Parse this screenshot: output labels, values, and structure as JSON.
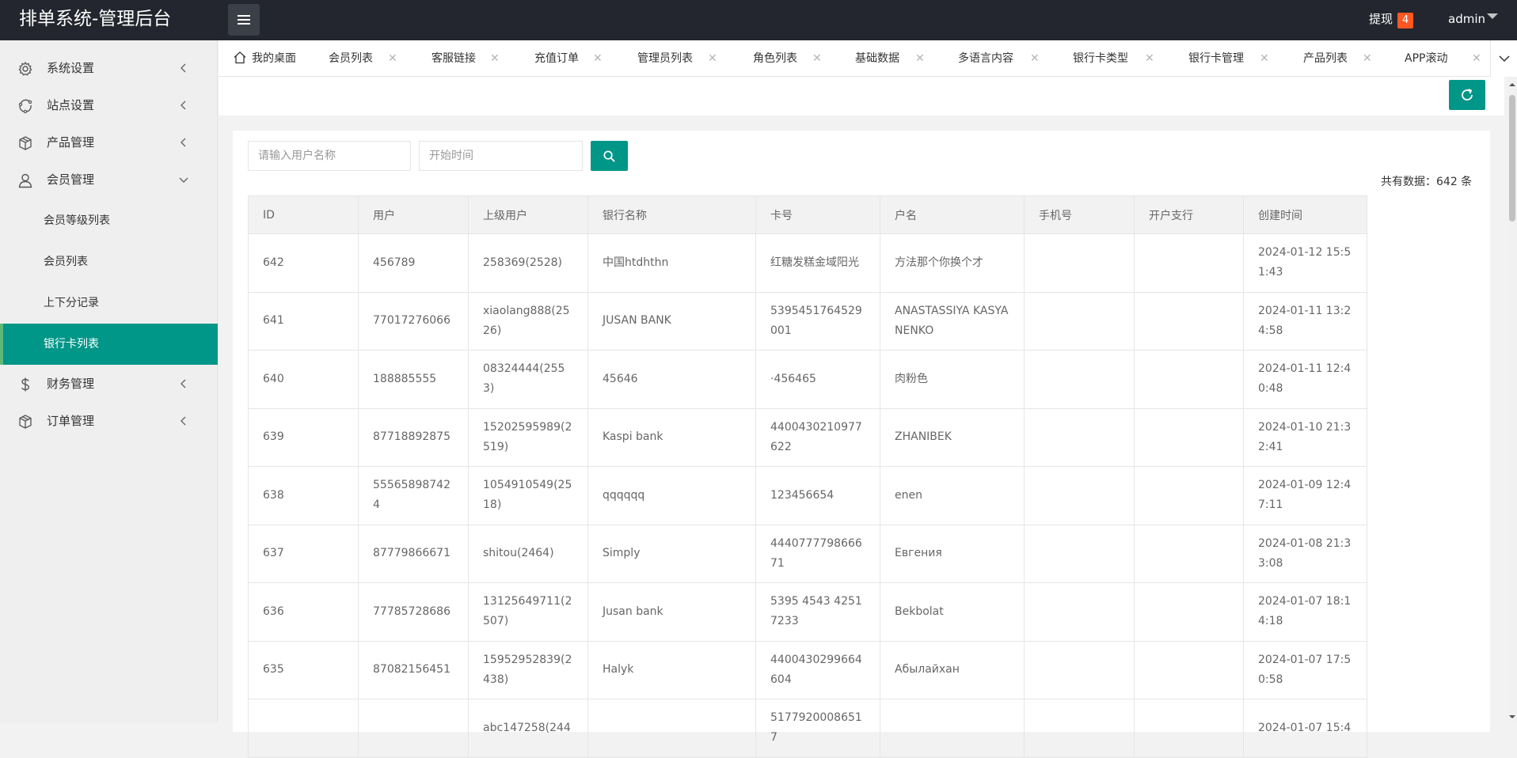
{
  "header": {
    "title": "排单系统-管理后台",
    "withdraw_label": "提现",
    "withdraw_count": "4",
    "user": "admin"
  },
  "sidebar": {
    "items": [
      {
        "label": "系统设置",
        "icon": "gear-icon"
      },
      {
        "label": "站点设置",
        "icon": "site-icon"
      },
      {
        "label": "产品管理",
        "icon": "box-icon"
      },
      {
        "label": "会员管理",
        "icon": "user-icon"
      },
      {
        "label": "财务管理",
        "icon": "dollar-icon"
      },
      {
        "label": "订单管理",
        "icon": "box-icon"
      }
    ],
    "member_subitems": [
      "会员等级列表",
      "会员列表",
      "上下分记录",
      "银行卡列表"
    ],
    "active_subitem": "银行卡列表"
  },
  "tabs": [
    "我的桌面",
    "会员列表",
    "客服链接",
    "充值订单",
    "管理员列表",
    "角色列表",
    "基础数据",
    "多语言内容",
    "银行卡类型",
    "银行卡管理",
    "产品列表",
    "APP滚动"
  ],
  "search": {
    "username_placeholder": "请输入用户名称",
    "start_time_placeholder": "开始时间"
  },
  "total_text": "共有数据：642 条",
  "table": {
    "columns": [
      "ID",
      "用户",
      "上级用户",
      "银行名称",
      "卡号",
      "户名",
      "手机号",
      "开户支行",
      "创建时间"
    ],
    "rows": [
      [
        "642",
        "456789",
        "258369(2528)",
        "中国htdhthn",
        "红糖发糕金域阳光",
        "方法那个你换个才",
        "",
        "",
        "2024-01-12 15:51:43"
      ],
      [
        "641",
        "77017276066",
        "xiaolang888(2526)",
        "JUSAN BANK",
        "5395451764529001",
        "ANASTASSIYA KASYANENKO",
        "",
        "",
        "2024-01-11 13:24:58"
      ],
      [
        "640",
        "188885555",
        "08324444(2553)",
        "45646",
        "·456465",
        "肉粉色",
        "",
        "",
        "2024-01-11 12:40:48"
      ],
      [
        "639",
        "87718892875",
        "15202595989(2519)",
        "Kaspi bank",
        "4400430210977622",
        "ZHANIBEK",
        "",
        "",
        "2024-01-10 21:32:41"
      ],
      [
        "638",
        "555658987424",
        "1054910549(2518)",
        "qqqqqq",
        "123456654",
        "enen",
        "",
        "",
        "2024-01-09 12:47:11"
      ],
      [
        "637",
        "87779866671",
        "shitou(2464)",
        "Simply",
        "4440777798666 71",
        "Евгения",
        "",
        "",
        "2024-01-08 21:33:08"
      ],
      [
        "636",
        "77785728686",
        "13125649711(2507)",
        "Jusan bank",
        "5395 4543 4251 7233",
        "Bekbolat",
        "",
        "",
        "2024-01-07 18:14:18"
      ],
      [
        "635",
        "87082156451",
        "15952952839(2438)",
        "Halyk",
        "4400430299664604",
        "Абылайхан",
        "",
        "",
        "2024-01-07 17:50:58"
      ],
      [
        "",
        "",
        "abc147258(244",
        "",
        "51779200086517",
        "",
        "",
        "",
        "2024-01-07 15:4"
      ]
    ]
  }
}
